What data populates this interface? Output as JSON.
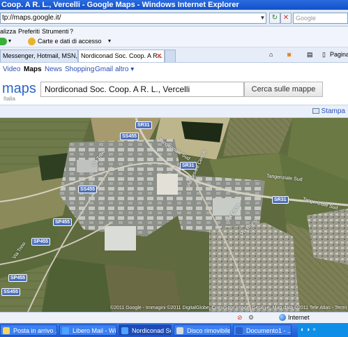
{
  "window": {
    "title": "Coop. A R. L., Vercelli - Google Maps - Windows Internet Explorer"
  },
  "addressbar": {
    "url": "tp://maps.google.it/",
    "search_placeholder": "Google"
  },
  "menu": {
    "items": [
      "alizza",
      "Preferiti",
      "Strumenti",
      "?"
    ]
  },
  "favorites": {
    "carte_label": "Carte e dati di accesso"
  },
  "tabs": [
    {
      "label": "Messenger, Hotmail, MSN, W..."
    },
    {
      "label": "Nordiconad Soc. Coop. A R..."
    }
  ],
  "toolbar": {
    "page_label": "Pagina"
  },
  "gnav": {
    "items": [
      "Video",
      "Maps",
      "News",
      "Shopping",
      "Gmail",
      "altro ▾"
    ]
  },
  "maps_logo": {
    "name": "maps",
    "region": "Italia"
  },
  "search": {
    "query": "Nordiconad Soc. Coop. A R. L., Vercelli",
    "button": "Cerca sulle mappe"
  },
  "actions": {
    "print": "Stampa"
  },
  "map": {
    "road_labels": [
      {
        "text": "SR31"
      },
      {
        "text": "SS455"
      },
      {
        "text": "SR31"
      },
      {
        "text": "SS455"
      },
      {
        "text": "SR31"
      },
      {
        "text": "SP455"
      },
      {
        "text": "SP455"
      },
      {
        "text": "SP455"
      },
      {
        "text": "SS455"
      }
    ],
    "street_names": [
      "Tangenziale Sud",
      "Tangenziale Sud",
      "Tangenziale Sud",
      "Via Trino",
      "Via Trino",
      "Via Cesare Cerruti",
      "Via Ettore",
      "Via Bruno"
    ],
    "copyright": "©2011 Google - Immagini ©2011 DigitalGlobe, Cnes/Spot Image, GeoEye, Map data ©2011 Tele Atlas - Termi"
  },
  "status": {
    "zone": "Internet"
  },
  "taskbar": {
    "items": [
      "Posta in arrivo ...",
      "Libero Mail - Wi...",
      "Nordiconad Soc...",
      "Disco rimovibile ...",
      "Documento1 - ..."
    ]
  }
}
